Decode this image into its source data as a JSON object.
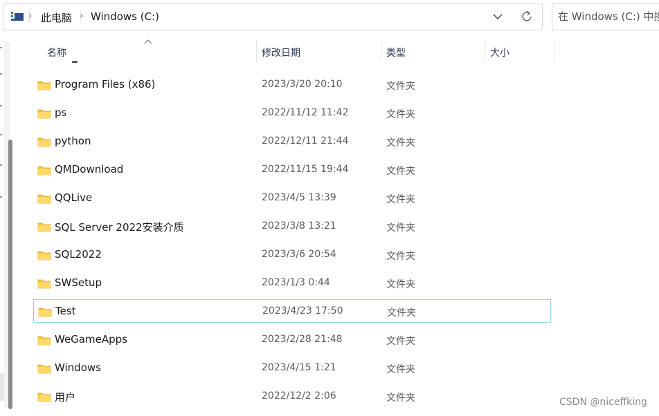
{
  "address_bar": {
    "location_icon": "this-pc-icon",
    "separator": "›",
    "breadcrumbs": [
      "此电脑",
      "Windows (C:)"
    ],
    "dropdown_icon": "chevron-down-icon",
    "refresh_icon": "refresh-icon"
  },
  "search": {
    "placeholder": "在 Windows (C:) 中搜索"
  },
  "columns": {
    "name": "名称",
    "modified": "修改日期",
    "type": "类型",
    "size": "大小"
  },
  "files": [
    {
      "name": "Program Files (x86)",
      "modified": "2023/3/20 20:10",
      "type": "文件夹",
      "selected": false
    },
    {
      "name": "ps",
      "modified": "2022/11/12 11:42",
      "type": "文件夹",
      "selected": false
    },
    {
      "name": "python",
      "modified": "2022/12/11 21:44",
      "type": "文件夹",
      "selected": false
    },
    {
      "name": "QMDownload",
      "modified": "2022/11/15 19:44",
      "type": "文件夹",
      "selected": false
    },
    {
      "name": "QQLive",
      "modified": "2023/4/5 13:39",
      "type": "文件夹",
      "selected": false
    },
    {
      "name": "SQL Server 2022安装介质",
      "modified": "2023/3/8 13:21",
      "type": "文件夹",
      "selected": false
    },
    {
      "name": "SQL2022",
      "modified": "2023/3/6 20:54",
      "type": "文件夹",
      "selected": false
    },
    {
      "name": "SWSetup",
      "modified": "2023/1/3 0:44",
      "type": "文件夹",
      "selected": false
    },
    {
      "name": "Test",
      "modified": "2023/4/23 17:50",
      "type": "文件夹",
      "selected": true
    },
    {
      "name": "WeGameApps",
      "modified": "2023/2/28 21:48",
      "type": "文件夹",
      "selected": false
    },
    {
      "name": "Windows",
      "modified": "2023/4/15 1:21",
      "type": "文件夹",
      "selected": false
    },
    {
      "name": "用户",
      "modified": "2022/12/2 2:06",
      "type": "文件夹",
      "selected": false
    }
  ],
  "watermark": "CSDN @niceffking",
  "colors": {
    "folder": "#f4c542",
    "folder_dark": "#e0a92a",
    "selection_border": "#99d1e6",
    "header_text": "#2d3a55"
  }
}
